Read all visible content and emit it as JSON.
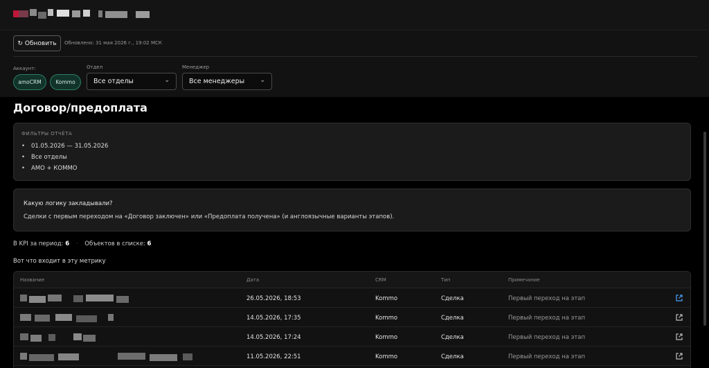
{
  "toolbar": {
    "refresh_icon": "↻",
    "refresh_label": "Обновить",
    "updated_text": "Обновлено: 31 мая 2026 г., 19:02 МСК"
  },
  "filters": {
    "account_label": "Аккаунт:",
    "accounts": [
      "amoCRM",
      "Kommo"
    ],
    "department_label": "Отдел",
    "department_value": "Все отделы",
    "manager_label": "Менеджер",
    "manager_value": "Все менеджеры"
  },
  "page": {
    "title": "Договор/предоплата"
  },
  "report_filters": {
    "title": "ФИЛЬТРЫ ОТЧЁТА",
    "items": [
      "01.05.2026 — 31.05.2026",
      "Все отделы",
      "АМО + КОММО"
    ]
  },
  "logic": {
    "question": "Какую логику закладывали?",
    "answer": "Сделки с первым переходом на «Договор заключен» или «Предоплата получена» (и англоязычные варианты этапов)."
  },
  "stats": {
    "kpi_label": "В KPI за период:",
    "kpi_value": "6",
    "list_label": "Объектов в списке:",
    "list_value": "6"
  },
  "metric_caption": "Вот что входит в эту метрику",
  "table": {
    "columns": [
      "Название",
      "Дата",
      "CRM",
      "Тип",
      "Примечание"
    ],
    "rows": [
      {
        "date": "26.05.2026, 18:53",
        "crm": "Kommo",
        "type": "Сделка",
        "note": "Первый переход на этап"
      },
      {
        "date": "14.05.2026, 17:35",
        "crm": "Kommo",
        "type": "Сделка",
        "note": "Первый переход на этап"
      },
      {
        "date": "14.05.2026, 17:24",
        "crm": "Kommo",
        "type": "Сделка",
        "note": "Первый переход на этап"
      },
      {
        "date": "11.05.2026, 22:51",
        "crm": "Kommo",
        "type": "Сделка",
        "note": "Первый переход на этап"
      }
    ]
  },
  "colors": {
    "accent": "#2a7f66",
    "link_blue": "#4ea3ff"
  },
  "icons": {
    "refresh": "refresh-icon",
    "chevron": "chevron-down-icon",
    "external": "external-link-icon"
  }
}
